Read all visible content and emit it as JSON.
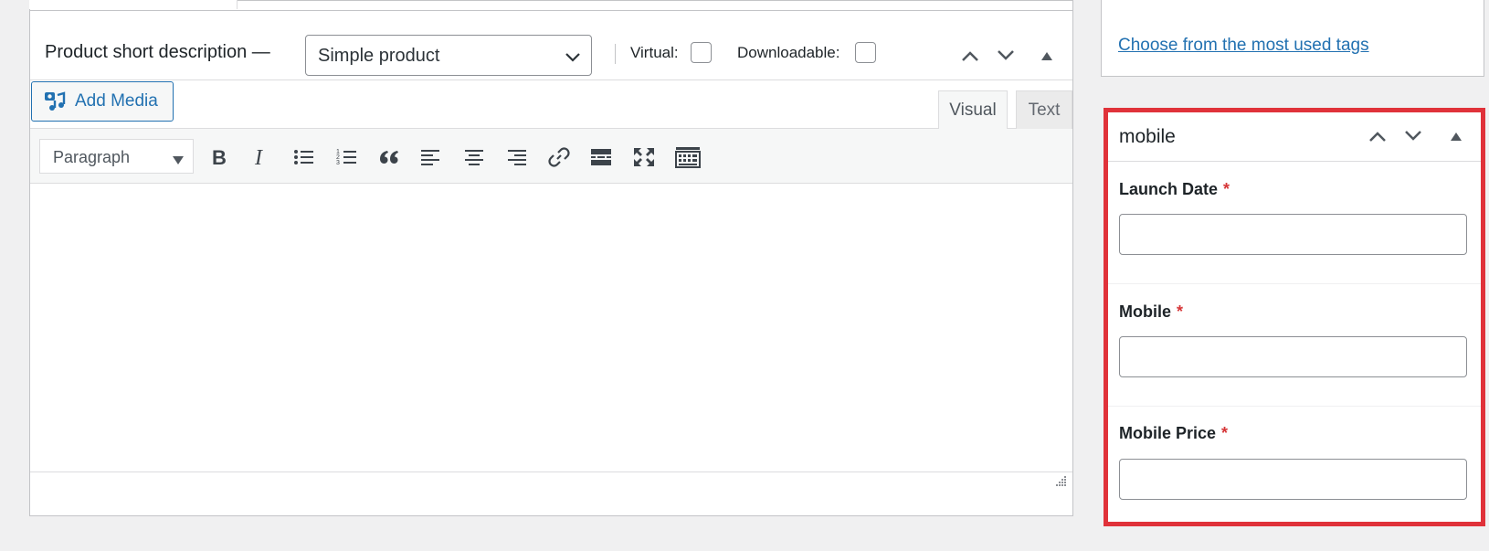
{
  "product_box": {
    "title": "Product short description —",
    "product_type": {
      "selected": "Simple product"
    },
    "virtual_label": "Virtual:",
    "downloadable_label": "Downloadable:",
    "virtual_checked": false,
    "downloadable_checked": false
  },
  "editor": {
    "add_media_label": "Add Media",
    "tabs": [
      {
        "label": "Visual",
        "active": true
      },
      {
        "label": "Text",
        "active": false
      }
    ],
    "format_select": "Paragraph",
    "toolbar_icons": [
      "bold-icon",
      "italic-icon",
      "bulleted-list-icon",
      "numbered-list-icon",
      "blockquote-icon",
      "align-left-icon",
      "align-center-icon",
      "align-right-icon",
      "link-icon",
      "read-more-icon",
      "fullscreen-icon",
      "toolbar-toggle-icon"
    ],
    "content": ""
  },
  "tags": {
    "most_used_link": "Choose from the most used tags"
  },
  "mobile_box": {
    "title": "mobile",
    "required_marker": "*",
    "fields": [
      {
        "label": "Launch Date",
        "value": ""
      },
      {
        "label": "Mobile",
        "value": ""
      },
      {
        "label": "Mobile Price",
        "value": ""
      }
    ]
  },
  "colors": {
    "accent": "#2271b1",
    "highlight_border": "#e0323a",
    "required": "#d63638"
  }
}
